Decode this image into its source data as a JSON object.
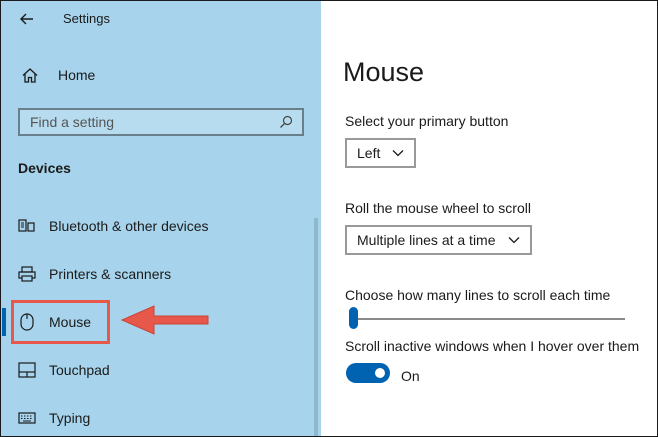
{
  "window": {
    "title": "Settings"
  },
  "sidebar": {
    "home_label": "Home",
    "search_placeholder": "Find a setting",
    "section_title": "Devices",
    "items": [
      {
        "label": "Bluetooth & other devices",
        "icon": "bluetooth-devices-icon"
      },
      {
        "label": "Printers & scanners",
        "icon": "printer-icon"
      },
      {
        "label": "Mouse",
        "icon": "mouse-icon",
        "active": true
      },
      {
        "label": "Touchpad",
        "icon": "touchpad-icon"
      },
      {
        "label": "Typing",
        "icon": "keyboard-icon"
      }
    ]
  },
  "main": {
    "title": "Mouse",
    "primary_button": {
      "label": "Select your primary button",
      "value": "Left"
    },
    "scroll_mode": {
      "label": "Roll the mouse wheel to scroll",
      "value": "Multiple lines at a time"
    },
    "lines_to_scroll": {
      "label": "Choose how many lines to scroll each time",
      "value_fraction": 0.0
    },
    "scroll_inactive": {
      "label": "Scroll inactive windows when I hover over them",
      "state": "On"
    }
  },
  "colors": {
    "sidebar_bg": "#a7d4ec",
    "accent": "#0063b1",
    "annotation": "#e8584a"
  }
}
